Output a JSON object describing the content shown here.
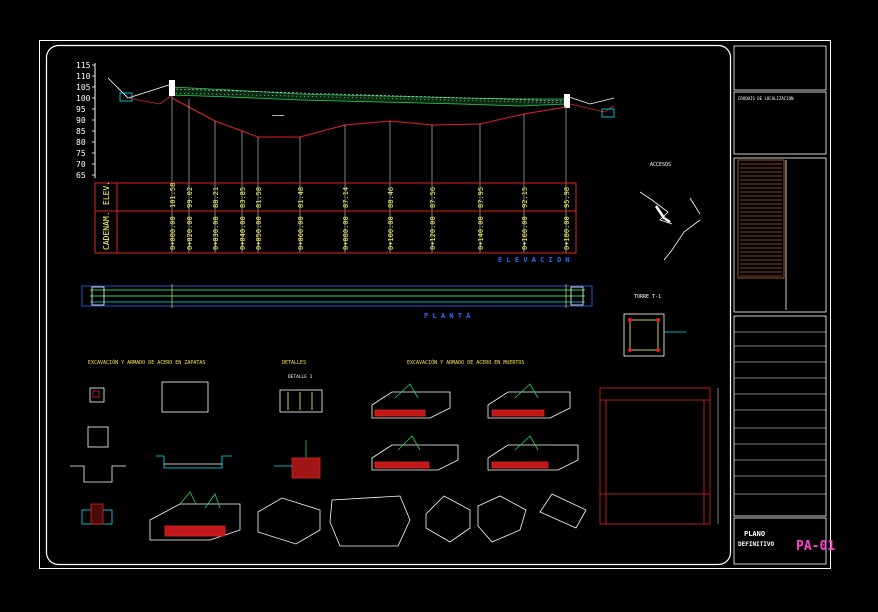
{
  "colors": {
    "background": "#000000",
    "frame": "#ffffff",
    "profile_line": "#e02424",
    "axis_text": "#ffffff",
    "table_grid": "#e02424",
    "values_text": "#ffff66",
    "title_blue": "#2a6cff",
    "cyan": "#00e5ff",
    "green": "#22d35a",
    "yellow": "#ffe24a",
    "magenta": "#ff4fd8",
    "pink_title": "#ff44cc"
  },
  "elevation_axis": {
    "ticks": [
      "115",
      "110",
      "105",
      "100",
      "95",
      "90",
      "85",
      "80",
      "75",
      "70",
      "65"
    ]
  },
  "profile_table": {
    "row_labels": [
      "ELEV.",
      "CADENAM."
    ],
    "elevations": [
      "101.58",
      "99.02",
      "88.21",
      "83.85",
      "81.58",
      "81.48",
      "87.14",
      "88.46",
      "87.56",
      "87.95",
      "92.15",
      "95.98"
    ],
    "chainages": [
      "0+000.00",
      "0+020.00",
      "0+030.00",
      "0+040.00",
      "0+050.00",
      "0+060.00",
      "0+080.00",
      "0+100.00",
      "0+120.00",
      "0+140.00",
      "0+160.00",
      "0+180.00"
    ]
  },
  "labels": {
    "elevacion": "E L E V A C I O N",
    "planta": "P L A N T A",
    "section1_title": "EXCAVACIÓN Y ARMADO DE ACERO EN ZAPATAS",
    "section2_title": "DETALLES",
    "section3_title": "EXCAVACIÓN Y ARMADO DE ACERO EN MUERTOS",
    "torre_title": "TORRE T-1",
    "acceso_title": "ACCESOS",
    "detalle_1": "DETALLE 1"
  },
  "title_block": {
    "project_line": "CROQUIS DE LOCALIZACION",
    "plano_label": "PLANO",
    "plano_desc": "DEFINITIVO",
    "sheet_code": "PA-01"
  }
}
